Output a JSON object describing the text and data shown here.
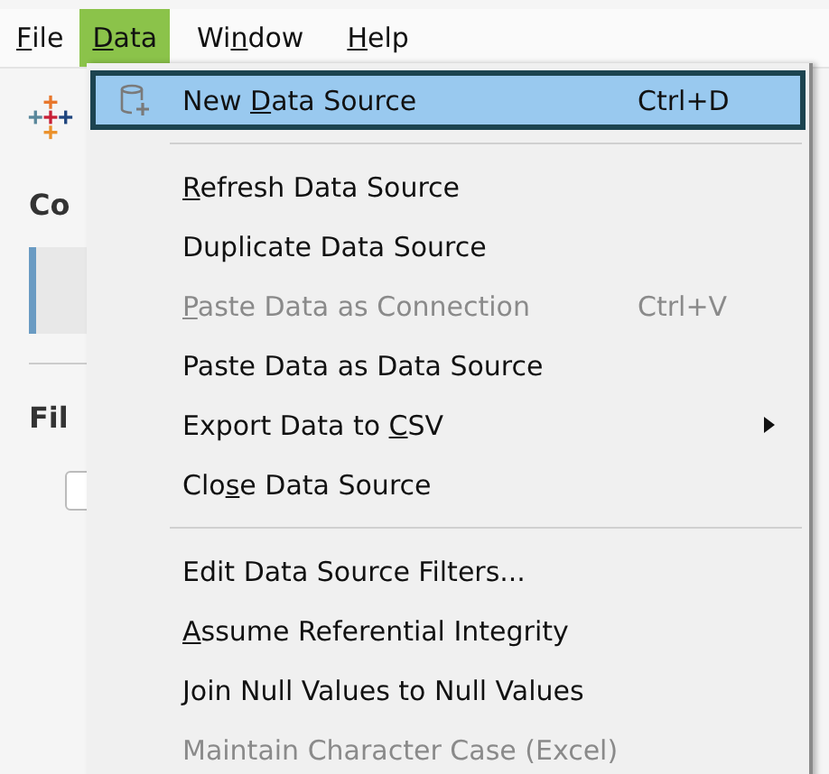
{
  "menu_bar": [
    {
      "key": "F",
      "after": "ile",
      "selected": false
    },
    {
      "key": "D",
      "after": "ata",
      "selected": true
    },
    {
      "before": "Wi",
      "key": "n",
      "after": "dow",
      "selected": false
    },
    {
      "key": "H",
      "after": "elp",
      "selected": false
    }
  ],
  "background": {
    "heading": "Co",
    "section_label": "Fil",
    "checkbox": {
      "checked": false
    }
  },
  "data_menu": {
    "items": [
      {
        "kind": "icon_item",
        "before": "New ",
        "key": "D",
        "after": "ata Source",
        "shortcut": "Ctrl+D",
        "selected": true,
        "disabled": false,
        "submenu": false
      },
      {
        "kind": "separator"
      },
      {
        "kind": "item",
        "key": "R",
        "after": "efresh Data Source",
        "selected": false,
        "disabled": false,
        "submenu": false
      },
      {
        "kind": "item",
        "text": "Duplicate Data Source",
        "selected": false,
        "disabled": false,
        "submenu": false
      },
      {
        "kind": "item",
        "key": "P",
        "after": "aste Data as Connection",
        "shortcut": "Ctrl+V",
        "selected": false,
        "disabled": true,
        "submenu": false
      },
      {
        "kind": "item",
        "text": "Paste Data as Data Source",
        "selected": false,
        "disabled": false,
        "submenu": false
      },
      {
        "kind": "item",
        "before": "Export Data to ",
        "key": "C",
        "after": "SV",
        "selected": false,
        "disabled": false,
        "submenu": true
      },
      {
        "kind": "item",
        "before": "Clo",
        "key": "s",
        "after": "e Data Source",
        "selected": false,
        "disabled": false,
        "submenu": false
      },
      {
        "kind": "separator"
      },
      {
        "kind": "item",
        "text": "Edit Data Source Filters...",
        "selected": false,
        "disabled": false,
        "submenu": false
      },
      {
        "kind": "item",
        "key": "A",
        "after": "ssume Referential Integrity",
        "selected": false,
        "disabled": false,
        "submenu": false
      },
      {
        "kind": "item",
        "text": "Join Null Values to Null Values",
        "selected": false,
        "disabled": false,
        "submenu": false
      },
      {
        "kind": "item",
        "text": "Maintain Character Case (Excel)",
        "selected": false,
        "disabled": true,
        "submenu": false
      }
    ]
  }
}
